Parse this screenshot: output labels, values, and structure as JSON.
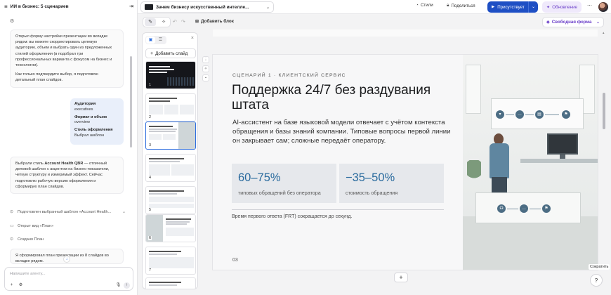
{
  "chat": {
    "title": "ИИ в бизнес: 5 сценариев",
    "messages": [
      {
        "p1": "Открыл форму настройки презентации во вкладке рядом: вы можете скорректировать целевую аудиторию, объем и выбрать один из предложенных стилей оформления (в подобрал три профессиональных варианта с фокусом на бизнес и технологии).",
        "p2": "Как только подтвердите выбор, я подготовлю детальный план слайдов."
      },
      {
        "p1_a": "Выбрали стиль ",
        "p1_b": "Account Health QBR",
        "p1_c": " — отличный деловой шаблон с акцентом на бизнес-показатели, четкую структуру и измеримый эффект. Сейчас подготовлю рабочую версию оформления и сформирую план слайдов."
      },
      {
        "p1": "Я сформировал план презентации из 8 слайдов во вкладке рядом."
      }
    ],
    "user_card": [
      {
        "key": "Аудитория",
        "value": "executives"
      },
      {
        "key": "Формат и объем",
        "value": "overview"
      },
      {
        "key": "Стиль оформления",
        "value": "Выбрал шаблон"
      }
    ],
    "status": [
      {
        "icon": "check-circle-icon",
        "text": "Подготовлен выбранный шаблон «Account Health..."
      },
      {
        "icon": "folder-icon",
        "text": "Открыт вид «План»"
      },
      {
        "icon": "check-circle-icon",
        "text": "Создано План"
      }
    ],
    "composer_placeholder": "Напишите агенту..."
  },
  "topbar": {
    "doc_title": "Зачем бизнесу искусственный интелле...",
    "styles": "Стили",
    "share": "Поделиться",
    "present": "Присутствует",
    "update": "Обновление"
  },
  "editor": {
    "add_block": "Добавить блок",
    "free_form": "Свободная форма"
  },
  "thumbs": {
    "add_slide": "Добавить слайд",
    "numbers": [
      "1",
      "2",
      "3",
      "4",
      "5",
      "6",
      "7"
    ]
  },
  "slide": {
    "overline": "СЦЕНАРИЙ 1 · КЛИЕНТСКИЙ СЕРВИС",
    "title": "Поддержка 24/7 без раздувания штата",
    "body": "AI-ассистент на базе языковой модели отвечает с учётом контекста обращения и базы знаний компании. Типовые вопросы первой линии он закрывает сам; сложные передаёт оператору.",
    "stats": [
      {
        "value": "60–75%",
        "label": "типовых обращений без оператора"
      },
      {
        "value": "−35–50%",
        "label": "стоимость обращения"
      }
    ],
    "footnote": "Время первого ответа (FRT) сокращается до секунд.",
    "page": "03"
  },
  "right": {
    "compress": "Сократить",
    "help": "?"
  },
  "colors": {
    "accent_blue": "#1e4fc4",
    "stat_value": "#2a6b9e",
    "purple": "#6b3fc9"
  }
}
